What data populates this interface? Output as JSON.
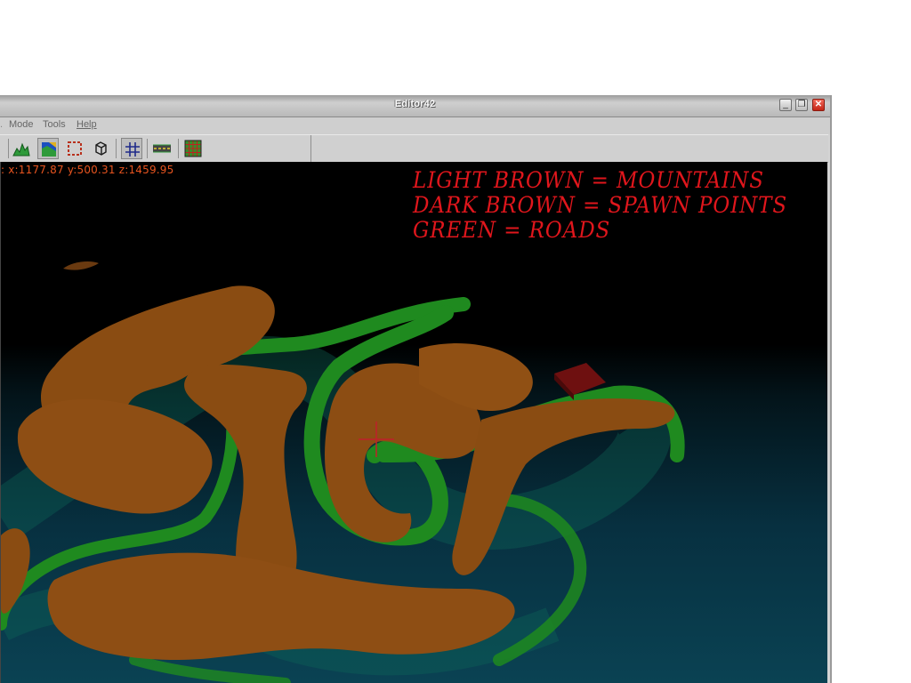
{
  "window": {
    "title": "Editor42"
  },
  "title_buttons": {
    "minimize": "_",
    "maximize": "❐",
    "close": "✕"
  },
  "menu": {
    "separator": ".",
    "items": [
      {
        "label": "Mode"
      },
      {
        "label": "Tools"
      },
      {
        "label": "Help"
      }
    ]
  },
  "toolbar": {
    "buttons": [
      {
        "icon": "terrain-height-icon",
        "pressed": false
      },
      {
        "icon": "texture-paint-icon",
        "pressed": true
      },
      {
        "icon": "selection-region-icon",
        "pressed": false
      },
      {
        "icon": "wireframe-cube-icon",
        "pressed": false
      },
      {
        "icon": "grid-icon",
        "pressed": true
      },
      {
        "icon": "road-tool-icon",
        "pressed": false
      },
      {
        "icon": "tile-map-icon",
        "pressed": false
      }
    ]
  },
  "viewport": {
    "coords": ": x:1177.87  y:500.31  z:1459.95",
    "legend": [
      "LIGHT BROWN  =  MOUNTAINS",
      "DARK BROWN  =  SPAWN POINTS",
      "GREEN  =  ROADS"
    ]
  },
  "colors": {
    "mountain": "#8a4c12",
    "spawn_point": "#6e1010",
    "road": "#1f8a1f",
    "legend_text": "#e0161c",
    "coords_text": "#e8541f",
    "crosshair": "#c0202a"
  }
}
